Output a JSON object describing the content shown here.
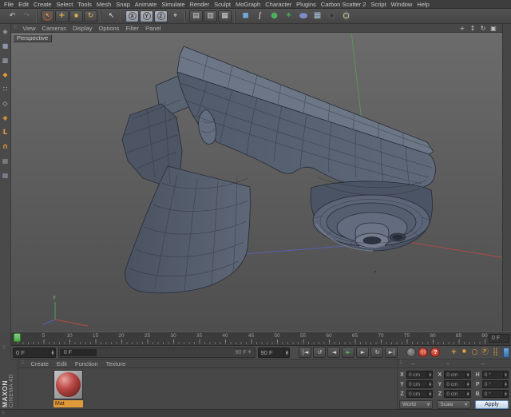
{
  "menu_bar": {
    "items": [
      "File",
      "Edit",
      "Create",
      "Select",
      "Tools",
      "Mesh",
      "Snap",
      "Animate",
      "Simulate",
      "Render",
      "Sculpt",
      "MoGraph",
      "Character",
      "Plugins",
      "Carbon Scatter 2",
      "Script",
      "Window",
      "Help"
    ]
  },
  "toolbar": {
    "groups": [
      {
        "name": "history",
        "items": [
          {
            "name": "undo",
            "glyph": "↶",
            "color": "#c6c6c6"
          },
          {
            "name": "redo",
            "glyph": "↷",
            "color": "#6e6e6e"
          }
        ]
      },
      {
        "name": "transform-tools",
        "items": [
          {
            "name": "live-selection",
            "glyph": "↖",
            "color": "#ececec",
            "ring": "#8a5634",
            "raised": true
          },
          {
            "name": "move",
            "glyph": "+",
            "color": "#e3b34a",
            "raised": true,
            "bold": true
          },
          {
            "name": "scale",
            "glyph": "◼",
            "color": "#e3b34a",
            "raised": true,
            "small": true
          },
          {
            "name": "rotate",
            "glyph": "↻",
            "color": "#e3b34a",
            "raised": true
          }
        ]
      },
      {
        "name": "recent-tool",
        "items": [
          {
            "name": "last-tool",
            "glyph": "↖",
            "color": "#e2e2e2"
          }
        ]
      },
      {
        "name": "axis-lock",
        "items": [
          {
            "name": "lock-x-axis",
            "glyph": "X",
            "plate": true
          },
          {
            "name": "lock-y-axis",
            "glyph": "Y",
            "plate": true
          },
          {
            "name": "lock-z-axis",
            "glyph": "Z",
            "plate": true
          },
          {
            "name": "coordinate-system",
            "glyph": "⌖",
            "color": "#d6d6d6"
          }
        ]
      },
      {
        "name": "render",
        "items": [
          {
            "name": "render-view",
            "glyph": "▤",
            "color": "#ccd2da",
            "raised": true
          },
          {
            "name": "render-region",
            "glyph": "▥",
            "color": "#ccd2da",
            "raised": true
          },
          {
            "name": "render-settings",
            "glyph": "▦",
            "color": "#ccd2da",
            "raised": true
          }
        ]
      },
      {
        "name": "create-objects",
        "items": [
          {
            "name": "add-cube",
            "glyph": "◼",
            "color": "#6fa9d8",
            "big": true
          },
          {
            "name": "spline-pen",
            "glyph": "∫",
            "color": "#ececec"
          },
          {
            "name": "subdivision-surface",
            "glyph": "●",
            "color": "#4fae5c",
            "big": true
          },
          {
            "name": "generator",
            "glyph": "✶",
            "color": "#4fae5c",
            "big": true
          },
          {
            "name": "deformer",
            "glyph": "●",
            "color": "#7f8cc8",
            "wide": true
          },
          {
            "name": "floor",
            "glyph": "▦",
            "color": "#a9c0d8",
            "big": true
          },
          {
            "name": "camera",
            "glyph": "◉",
            "color": "#33383f",
            "big": true,
            "dark": true
          },
          {
            "name": "light",
            "glyph": "○",
            "color": "#efe9c4",
            "glow": true
          }
        ]
      }
    ]
  },
  "left_toolbar": {
    "items": [
      {
        "name": "convert-editable",
        "glyph": "◆",
        "color": "#8f8f8f"
      },
      {
        "name": "model-mode",
        "glyph": "■",
        "color": "#8d96a8"
      },
      {
        "name": "texture-mode",
        "glyph": "▩",
        "color": "#9aa4b4"
      },
      {
        "name": "workplane-mode",
        "glyph": "◆",
        "color": "#e0973c"
      },
      {
        "name": "points-mode",
        "glyph": "∷",
        "color": "#d8d8d8"
      },
      {
        "name": "edges-mode",
        "glyph": "◇",
        "color": "#d0d0d0"
      },
      {
        "name": "polygons-mode",
        "glyph": "◆",
        "color": "#cf8a3e"
      },
      {
        "name": "enable-axis",
        "glyph": "L",
        "color": "#e0973c",
        "bold": true
      },
      {
        "name": "snap",
        "glyph": "∩",
        "color": "#e0973c",
        "bold": true
      },
      {
        "name": "workplane-grid",
        "glyph": "▦",
        "color": "#909090"
      },
      {
        "name": "workplane-locked",
        "glyph": "▦",
        "color": "#8a94b0"
      }
    ]
  },
  "viewport": {
    "menu_items": [
      "View",
      "Cameras",
      "Display",
      "Options",
      "Filter",
      "Panel"
    ],
    "nav_icons": [
      {
        "name": "pan",
        "glyph": "+"
      },
      {
        "name": "zoom",
        "glyph": "↕"
      },
      {
        "name": "orbit",
        "glyph": "↻"
      },
      {
        "name": "toggle-view",
        "glyph": "▣"
      }
    ],
    "view_label": "Perspective",
    "gizmo_axis_label": "Y",
    "axis_colors": {
      "x": "#b84a42",
      "y": "#55a055",
      "z": "#5a60bd"
    }
  },
  "timeline": {
    "labels": [
      "0",
      "5",
      "10",
      "15",
      "20",
      "25",
      "30",
      "35",
      "40",
      "45",
      "50",
      "55",
      "60",
      "65",
      "70",
      "75",
      "80",
      "85",
      "90"
    ],
    "playhead_frame": 0,
    "frame_display": "0 F"
  },
  "transport": {
    "current_frame": "0 F",
    "range_start": "0 F",
    "range_end": "90 F",
    "end_frame": "90 F",
    "buttons": [
      {
        "name": "goto-start",
        "glyph": "|◄"
      },
      {
        "name": "previous-key",
        "glyph": "↺"
      },
      {
        "name": "previous-frame",
        "glyph": "◄"
      },
      {
        "name": "play",
        "glyph": "►",
        "color": "#4fc24f"
      },
      {
        "name": "next-frame",
        "glyph": "►"
      },
      {
        "name": "next-key",
        "glyph": "↻"
      },
      {
        "name": "goto-end",
        "glyph": "►|"
      }
    ],
    "record_buttons": [
      {
        "name": "record-objects",
        "kind": "gray",
        "glyph": ""
      },
      {
        "name": "record-keyframe",
        "kind": "red",
        "glyph": "( )"
      },
      {
        "name": "autokeying",
        "kind": "red",
        "glyph": "?",
        "question": true
      }
    ],
    "key_toggles": [
      {
        "name": "key-position",
        "glyph": "+",
        "bold": true
      },
      {
        "name": "key-scale",
        "glyph": "◼",
        "small": true
      },
      {
        "name": "key-rotation",
        "glyph": "○"
      },
      {
        "name": "key-parameter",
        "glyph": "Ⓟ"
      },
      {
        "name": "key-pla",
        "glyph": "⣿"
      }
    ],
    "accent": "#e8a33c"
  },
  "materials": {
    "menu_items": [
      "Create",
      "Edit",
      "Function",
      "Texture"
    ],
    "items": [
      {
        "label": "Mat"
      }
    ]
  },
  "coordinates": {
    "columns": [
      {
        "id": "position",
        "header": "–",
        "rows": [
          {
            "label": "X",
            "value": "0 cm"
          },
          {
            "label": "Y",
            "value": "0 cm"
          },
          {
            "label": "Z",
            "value": "0 cm"
          }
        ],
        "footer": {
          "type": "select",
          "label": "World"
        }
      },
      {
        "id": "size",
        "header": "–",
        "rows": [
          {
            "label": "X",
            "value": "0 cm"
          },
          {
            "label": "Y",
            "value": "0 cm"
          },
          {
            "label": "Z",
            "value": "0 cm"
          }
        ],
        "footer": {
          "type": "select",
          "label": "Scale"
        }
      },
      {
        "id": "rotation",
        "header": "–",
        "rows": [
          {
            "label": "H",
            "value": "0 °"
          },
          {
            "label": "P",
            "value": "0 °"
          },
          {
            "label": "B",
            "value": "0 °"
          }
        ],
        "footer": {
          "type": "button",
          "label": "Apply"
        }
      }
    ]
  },
  "branding": {
    "line1": "MAXON",
    "line2": "CINEMA 4D"
  }
}
